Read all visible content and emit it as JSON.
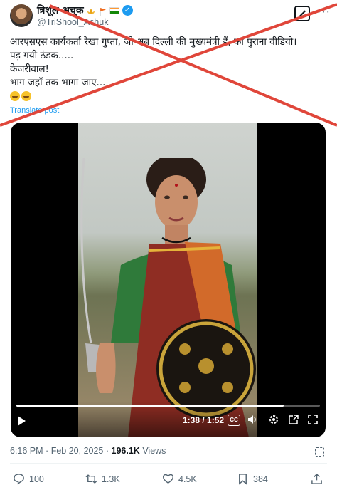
{
  "author": {
    "display_name": "त्रिशूल अचूक",
    "handle": "@TriShool_Achuk"
  },
  "tweet": {
    "lines": [
      "आरएसएस कार्यकर्ता रेखा गुप्ता, जो अब दिल्ली की मुख्यमंत्री हैं, का पुराना वीडियो।",
      "पड़ गयी ठंडक.....",
      "केजरीवाल!",
      "भाग जहाँ तक भागा जाए..."
    ],
    "translate_label": "Translate post"
  },
  "video": {
    "time": "1:38 / 1:52",
    "progress": 0.88,
    "cc_label": "CC"
  },
  "meta": {
    "time": "6:16 PM",
    "separator": "·",
    "date": "Feb 20, 2025",
    "views_count": "196.1K",
    "views_label": "Views"
  },
  "actions": {
    "replies": "100",
    "reposts": "1.3K",
    "likes": "4.5K",
    "bookmarks": "384"
  },
  "colors": {
    "accent": "#1d9bf0",
    "cross": "#e0463a",
    "muted": "#536471"
  }
}
